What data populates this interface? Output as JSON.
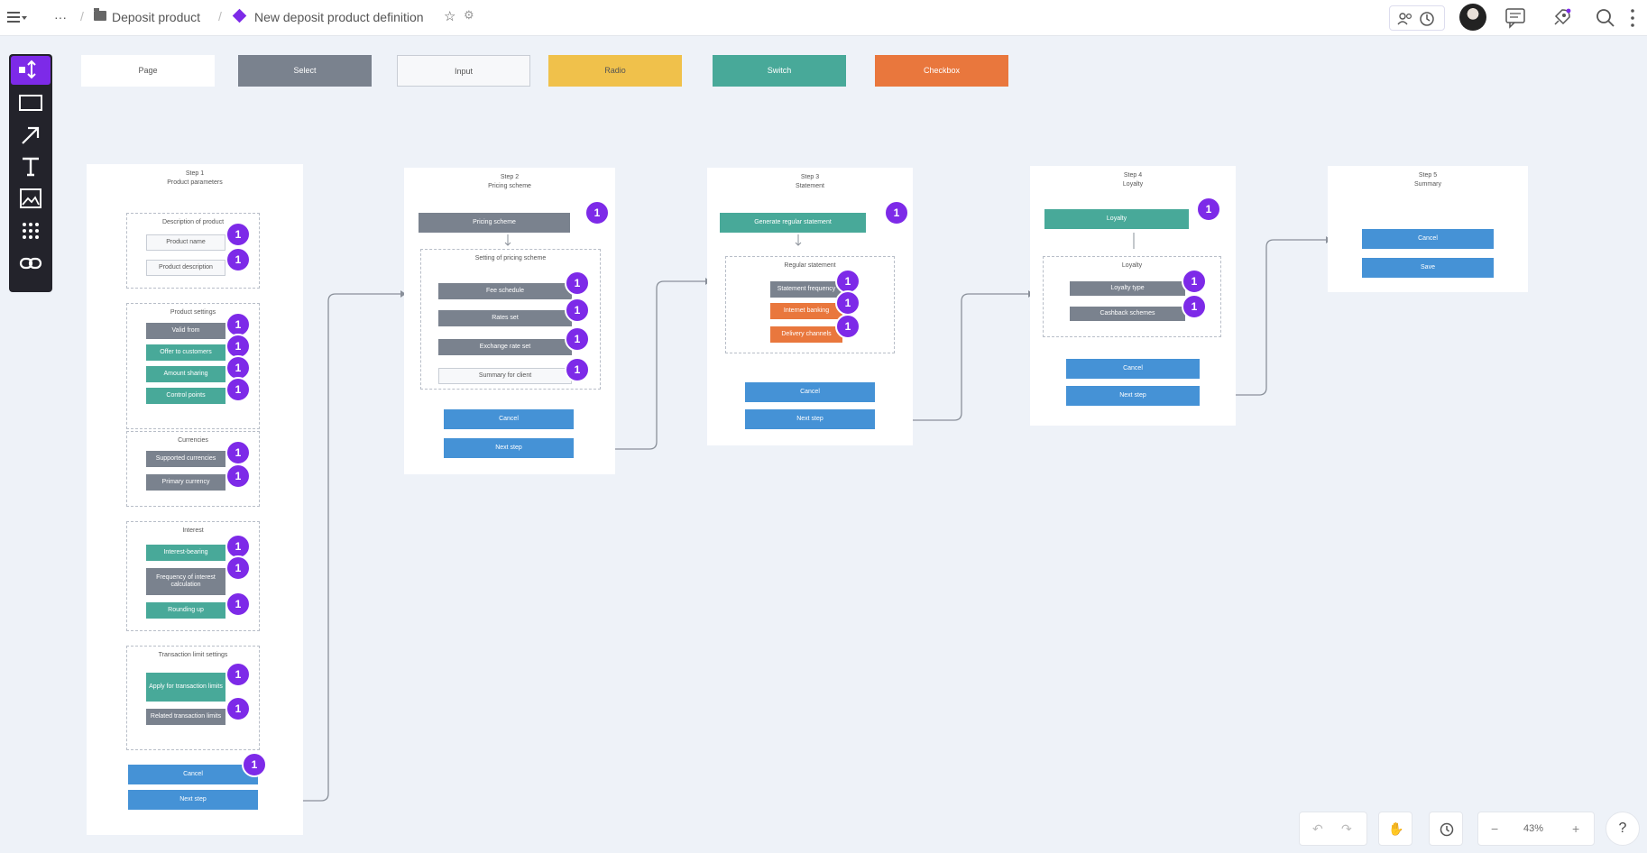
{
  "topbar": {
    "more": "···",
    "sep": "/",
    "folder_name": "Deposit product",
    "board_name": "New deposit product definition",
    "star": "☆",
    "gear": "⚙"
  },
  "legend": [
    {
      "label": "Page",
      "color": "#ffffff",
      "text": "#555555"
    },
    {
      "label": "Select",
      "color": "#7a828e",
      "text": "#ffffff"
    },
    {
      "label": "Input",
      "color": "#f7f8fa",
      "text": "#555555"
    },
    {
      "label": "Radio",
      "color": "#f0c14b",
      "text": "#555555"
    },
    {
      "label": "Switch",
      "color": "#48a999",
      "text": "#ffffff"
    },
    {
      "label": "Checkbox",
      "color": "#e9773d",
      "text": "#ffffff"
    }
  ],
  "steps": {
    "s1": {
      "title": "Step 1",
      "subtitle": "Product parameters",
      "desc_group": "Description of product",
      "product_name": "Product name",
      "product_desc": "Product description",
      "settings_group": "Product settings",
      "valid_from": "Valid from",
      "offer": "Offer to customers",
      "amount_sharing": "Amount sharing",
      "control_points": "Control points",
      "currencies_group": "Currencies",
      "supported_currencies": "Supported currencies",
      "primary_currency": "Primary currency",
      "interest_group": "Interest",
      "interest_bearing": "Interest-bearing",
      "frequency": "Frequency of interest calculation",
      "rounding": "Rounding up",
      "trx_group": "Transaction limit settings",
      "apply_limits": "Apply for transaction limits",
      "related_limits": "Related transaction limits",
      "cancel": "Cancel",
      "next": "Next step"
    },
    "s2": {
      "title": "Step 2",
      "subtitle": "Pricing scheme",
      "pricing_scheme": "Pricing scheme",
      "group": "Setting of pricing scheme",
      "fee_schedule": "Fee schedule",
      "rates_set": "Rates set",
      "exchange": "Exchange rate set",
      "summary": "Summary for client",
      "cancel": "Cancel",
      "next": "Next step"
    },
    "s3": {
      "title": "Step 3",
      "subtitle": "Statement",
      "generate": "Generate regular statement",
      "group": "Regular statement",
      "frequency": "Statement frequency",
      "channel": "Internet banking",
      "delivery": "Delivery channels",
      "cancel": "Cancel",
      "next": "Next step"
    },
    "s4": {
      "title": "Step 4",
      "subtitle": "Loyalty",
      "loyalty": "Loyalty",
      "group": "Loyalty",
      "loyalty_type": "Loyalty type",
      "cashback": "Cashback schemes",
      "cancel": "Cancel",
      "next": "Next step"
    },
    "s5": {
      "title": "Step 5",
      "subtitle": "Summary",
      "cancel": "Cancel",
      "save": "Save"
    }
  },
  "badge": "1",
  "controls": {
    "undo": "↶",
    "redo": "↷",
    "hand": "✋",
    "minus": "−",
    "zoom": "43%",
    "plus": "+",
    "help": "?"
  }
}
